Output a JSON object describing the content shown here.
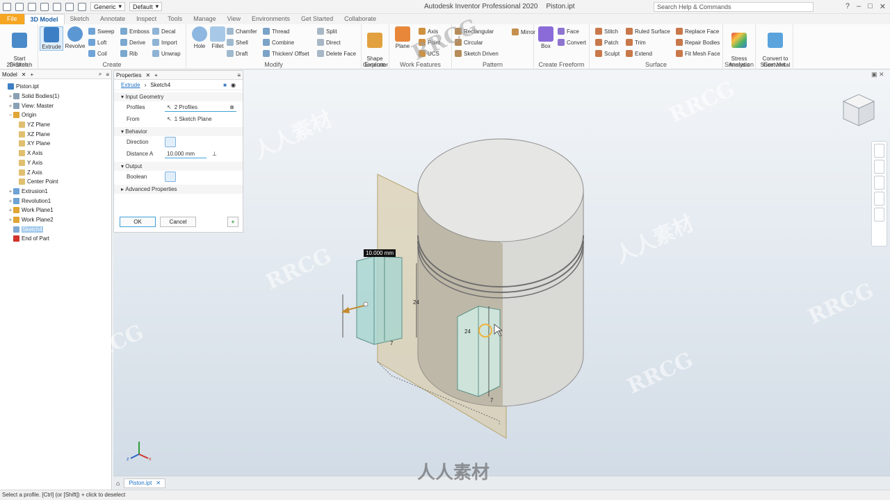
{
  "app": {
    "title": "Autodesk Inventor Professional 2020",
    "document": "Piston.ipt",
    "search_placeholder": "Search Help & Commands",
    "qat_appearance": "Generic",
    "qat_style": "Default"
  },
  "tabs": [
    "File",
    "3D Model",
    "Sketch",
    "Annotate",
    "Inspect",
    "Tools",
    "Manage",
    "View",
    "Environments",
    "Get Started",
    "Collaborate"
  ],
  "ribbon": {
    "sketch": {
      "label": "Sketch",
      "start": "Start\n2D Sketch"
    },
    "create": {
      "label": "Create",
      "extrude": "Extrude",
      "revolve": "Revolve",
      "col1": [
        "Sweep",
        "Loft",
        "Coil"
      ],
      "col2": [
        "Emboss",
        "Derive",
        "Rib"
      ],
      "col3": [
        "Decal",
        "Import",
        "Unwrap"
      ]
    },
    "modify": {
      "label": "Modify",
      "hole": "Hole",
      "fillet": "Fillet",
      "col1": [
        "Chamfer",
        "Shell",
        "Draft"
      ],
      "col2": [
        "Thread",
        "Combine",
        "Thicken/ Offset"
      ],
      "col3": [
        "Split",
        "Direct",
        "Delete Face"
      ]
    },
    "explore": {
      "label": "Explore",
      "shape": "Shape\nGenerator"
    },
    "workfeatures": {
      "label": "Work Features",
      "plane": "Plane",
      "items": [
        "Axis",
        "Point",
        "UCS"
      ]
    },
    "pattern": {
      "label": "Pattern",
      "items": [
        "Rectangular",
        "Circular",
        "Sketch Driven"
      ],
      "mirror": "Mirror"
    },
    "freeform": {
      "label": "Create Freeform",
      "box": "Box",
      "items": [
        "Face",
        "Convert"
      ]
    },
    "surface": {
      "label": "Surface",
      "col1": [
        "Stitch",
        "Patch",
        "Sculpt"
      ],
      "col2": [
        "Ruled Surface",
        "Trim",
        "Extend"
      ],
      "col3": [
        "Replace Face",
        "Repair Bodies",
        "Fit Mesh Face"
      ]
    },
    "simulation": {
      "label": "Simulation",
      "stress": "Stress\nAnalysis"
    },
    "convert": {
      "label": "Convert",
      "sheet": "Convert to\nSheet Metal"
    }
  },
  "model": {
    "tab": "Model",
    "tree": [
      {
        "label": "Piston.ipt",
        "level": 0,
        "exp": ""
      },
      {
        "label": "Solid Bodies(1)",
        "level": 1,
        "exp": "+"
      },
      {
        "label": "View: Master",
        "level": 1,
        "exp": "+"
      },
      {
        "label": "Origin",
        "level": 1,
        "exp": "−"
      },
      {
        "label": "YZ Plane",
        "level": 2,
        "exp": ""
      },
      {
        "label": "XZ Plane",
        "level": 2,
        "exp": ""
      },
      {
        "label": "XY Plane",
        "level": 2,
        "exp": ""
      },
      {
        "label": "X Axis",
        "level": 2,
        "exp": ""
      },
      {
        "label": "Y Axis",
        "level": 2,
        "exp": ""
      },
      {
        "label": "Z Axis",
        "level": 2,
        "exp": ""
      },
      {
        "label": "Center Point",
        "level": 2,
        "exp": ""
      },
      {
        "label": "Extrusion1",
        "level": 1,
        "exp": "+"
      },
      {
        "label": "Revolution1",
        "level": 1,
        "exp": "+"
      },
      {
        "label": "Work Plane1",
        "level": 1,
        "exp": "+"
      },
      {
        "label": "Work Plane2",
        "level": 1,
        "exp": "+"
      },
      {
        "label": "Sketch4",
        "level": 1,
        "exp": "",
        "highlight": true
      },
      {
        "label": "End of Part",
        "level": 1,
        "exp": ""
      }
    ]
  },
  "properties": {
    "tab": "Properties",
    "feature": "Extrude",
    "sketch": "Sketch4",
    "input_geometry": "Input Geometry",
    "profiles_label": "Profiles",
    "profiles_value": "2 Profiles",
    "from_label": "From",
    "from_value": "1 Sketch Plane",
    "behavior": "Behavior",
    "direction_label": "Direction",
    "distance_label": "Distance A",
    "distance_value": "10.000 mm",
    "output": "Output",
    "boolean_label": "Boolean",
    "advanced": "Advanced Properties",
    "ok": "OK",
    "cancel": "Cancel"
  },
  "viewport": {
    "dim_label": "10.000 mm",
    "dims": [
      "24",
      "7",
      "24",
      "7"
    ]
  },
  "doctab": "Piston.ipt",
  "status": "Select a profile. [Ctrl] (or [Shift]) + click to deselect",
  "colors": {
    "accent": "#1b70c4",
    "file_tab": "#f6a623",
    "selection": "#9ec7ec"
  },
  "watermarks": [
    "RRCG",
    "人人素材"
  ]
}
